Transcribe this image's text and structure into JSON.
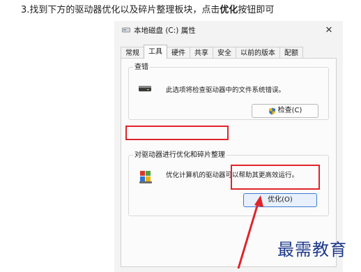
{
  "instruction": {
    "prefix": "3.找到下方的驱动器优化以及碎片整理板块，点击",
    "bold": "优化",
    "suffix": "按钮即可"
  },
  "dialog": {
    "title": "本地磁盘 (C:) 属性",
    "close_glyph": "✕",
    "tabs": [
      "常规",
      "工具",
      "硬件",
      "共享",
      "安全",
      "以前的版本",
      "配额"
    ],
    "active_tab": "工具"
  },
  "error_check": {
    "title": "查错",
    "description": "此选项将检查驱动器中的文件系统错误。",
    "button_label": "检查(C)"
  },
  "optimize": {
    "title": "对驱动器进行优化和碎片整理",
    "description": "优化计算机的驱动器可以帮助其更高效运行。",
    "button_label": "优化(O)"
  },
  "watermark": "最需教育",
  "colors": {
    "highlight": "#e0232a",
    "arrow": "#e0232a",
    "watermark": "#1e3a8a",
    "accent": "#3c7bd6"
  }
}
